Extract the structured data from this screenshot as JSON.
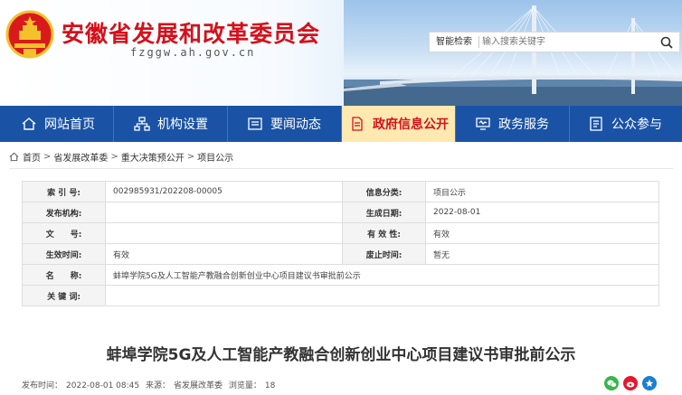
{
  "header": {
    "title": "安徽省发展和改革委员会",
    "domain": "fzggw.ah.gov.cn",
    "search": {
      "label": "智能检索",
      "placeholder": "输入搜索关键字"
    }
  },
  "nav": [
    {
      "label": "网站首页",
      "icon": "home-icon"
    },
    {
      "label": "机构设置",
      "icon": "org-chart-icon"
    },
    {
      "label": "要闻动态",
      "icon": "news-icon"
    },
    {
      "label": "政府信息公开",
      "icon": "document-icon",
      "active": true
    },
    {
      "label": "政务服务",
      "icon": "monitor-icon"
    },
    {
      "label": "公众参与",
      "icon": "people-icon"
    }
  ],
  "breadcrumb": [
    "首页",
    "省发展改革委",
    "重大决策预公开",
    "项目公示"
  ],
  "meta": {
    "index_label": "索 引 号:",
    "index_value": "002985931/202208-00005",
    "category_label": "信息分类:",
    "category_value": "项目公示",
    "publisher_label": "发布机构:",
    "publisher_value": "",
    "created_label": "生成日期:",
    "created_value": "2022-08-01",
    "docno_label": "文　　号:",
    "docno_value": "",
    "validity_label": "有 效 性:",
    "validity_value": "有效",
    "effective_label": "生效时间:",
    "effective_value": "有效",
    "repeal_label": "废止时间:",
    "repeal_value": "暂无",
    "name_label": "名　　称:",
    "name_value": "蚌埠学院5G及人工智能产教融合创新创业中心项目建议书审批前公示",
    "keywords_label": "关 键 词:",
    "keywords_value": ""
  },
  "article": {
    "title": "蚌埠学院5G及人工智能产教融合创新创业中心项目建议书审批前公示",
    "publish_label": "发布时间：",
    "publish_time": "2022-08-01 08:45",
    "source_label": "来源：",
    "source": "省发展改革委",
    "views_label": "浏览量：",
    "views": "18"
  },
  "colors": {
    "brand_red": "#d5101a",
    "nav_blue": "#1a53a6",
    "wechat": "#3ab54a",
    "weibo": "#e6162d"
  }
}
